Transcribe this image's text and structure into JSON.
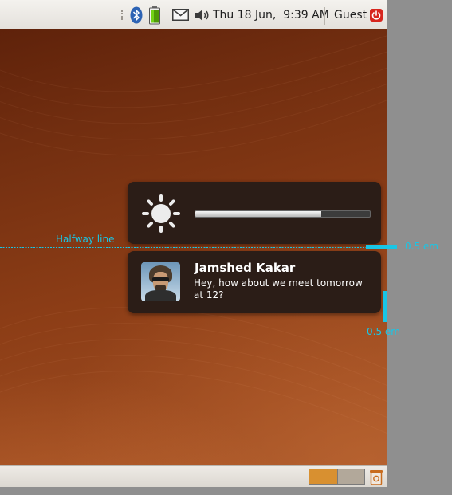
{
  "top_panel": {
    "icons": [
      "bluetooth-icon",
      "battery-icon",
      "mail-icon",
      "volume-icon"
    ],
    "datetime": "Thu 18 Jun,  9:39 AM",
    "user": "Guest",
    "session_icon": "power-icon"
  },
  "brightness_notification": {
    "icon": "brightness-icon",
    "level": 0.72
  },
  "message_notification": {
    "avatar": "avatar-photo",
    "sender": "Jamshed Kakar",
    "body_line1": "Hey, how about we meet tomorrow",
    "body_line2": "at 12?"
  },
  "annotations": {
    "halfway_label": "Halfway line",
    "spacing_label_right": "0.5 em",
    "spacing_label_bottom": "0.5 em",
    "guide_color": "#19c6e6"
  },
  "bottom_panel": {
    "workspaces": [
      "workspace-1",
      "workspace-2"
    ],
    "active_workspace_color": "#d89030",
    "inactive_workspace_color": "#b2a89a",
    "trash_icon": "trash-icon"
  },
  "colors": {
    "bubble_bg": "#2b1d17",
    "wallpaper": "#8c3d16",
    "panel": "#ebe8e3"
  }
}
